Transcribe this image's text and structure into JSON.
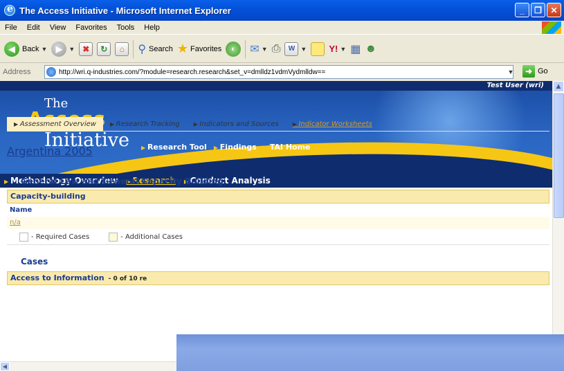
{
  "window": {
    "title": "The Access Initiative - Microsoft Internet Explorer"
  },
  "menu": [
    "File",
    "Edit",
    "View",
    "Favorites",
    "Tools",
    "Help"
  ],
  "toolbar": {
    "back": "Back",
    "search": "Search",
    "favorites": "Favorites"
  },
  "address": {
    "label": "Address",
    "url": "http://wri.q-industries.com/?module=research.research&set_v=dmlldz1vdmVydmlldw==",
    "go": "Go"
  },
  "site": {
    "user": "Test User (wri)",
    "logo": {
      "line1": "The",
      "line2": "Access",
      "line3": "Initiative"
    },
    "banner_links": [
      "Research Tool",
      "Findings",
      "TAI Home"
    ],
    "nav": [
      {
        "label": "Methodology Overview"
      },
      {
        "label": "Research"
      },
      {
        "label": "Conduct Analysis"
      }
    ],
    "subtabs": [
      "Assessment Overview",
      "Research Tracking",
      "Indicators and Sources",
      "Indicator Worksheets"
    ]
  },
  "page": {
    "title": "Argentina 2005",
    "section": "General Law and General Capacity Building",
    "capacity_header": "Capacity-building",
    "name_col": "Name",
    "name_value": "n/a",
    "legend_required": "- Required Cases",
    "legend_additional": "- Additional Cases",
    "cases_title": "Cases",
    "cases_row": "Access to Information",
    "cases_count": "- 0 of 10 re"
  }
}
